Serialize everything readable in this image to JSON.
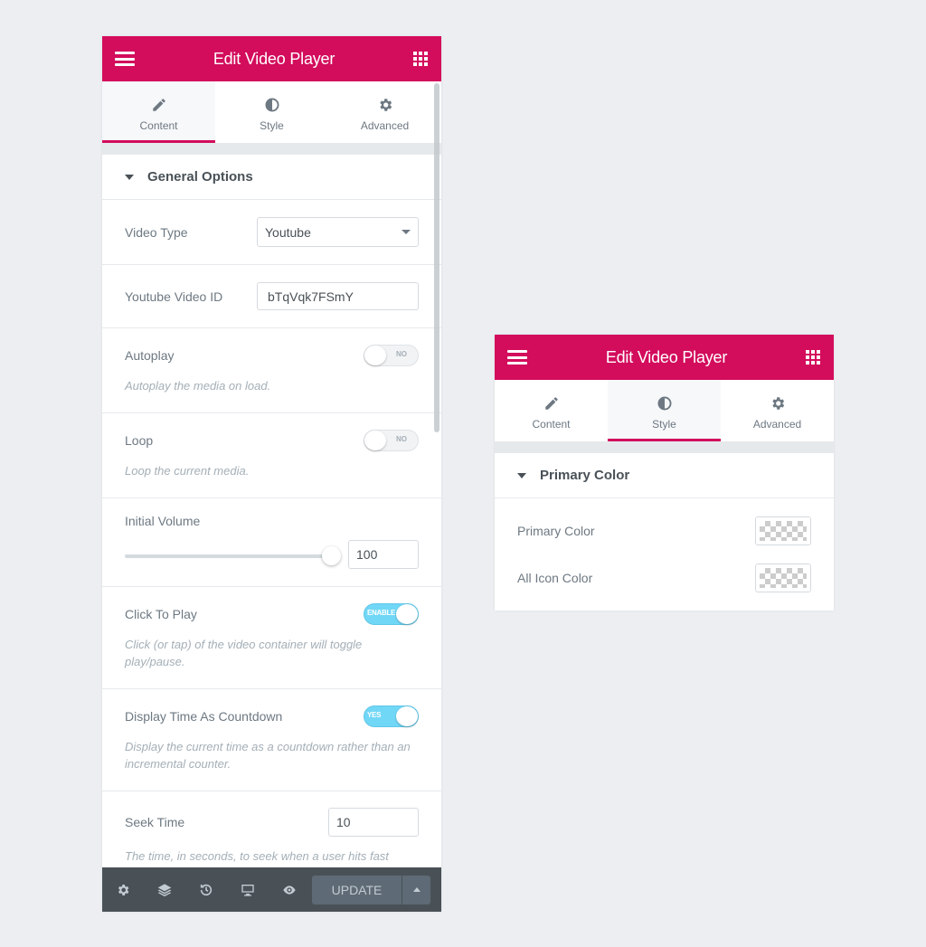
{
  "left_panel": {
    "header_title": "Edit Video Player",
    "tabs": [
      {
        "label": "Content",
        "icon": "pencil-icon",
        "active": true
      },
      {
        "label": "Style",
        "icon": "contrast-icon",
        "active": false
      },
      {
        "label": "Advanced",
        "icon": "gear-icon",
        "active": false
      }
    ],
    "section_title": "General Options",
    "video_type": {
      "label": "Video Type",
      "value": "Youtube"
    },
    "video_id": {
      "label": "Youtube Video ID",
      "value": "bTqVqk7FSmY"
    },
    "autoplay": {
      "label": "Autoplay",
      "desc": "Autoplay the media on load.",
      "switch_text": "NO",
      "on": false
    },
    "loop": {
      "label": "Loop",
      "desc": "Loop the current media.",
      "switch_text": "NO",
      "on": false
    },
    "initial_volume": {
      "label": "Initial Volume",
      "value": "100",
      "level": 1.0
    },
    "click_to_play": {
      "label": "Click To Play",
      "desc": "Click (or tap) of the video container will toggle play/pause.",
      "switch_text": "ENABLE",
      "on": true
    },
    "countdown": {
      "label": "Display Time As Countdown",
      "desc": "Display the current time as a countdown rather than an incremental counter.",
      "switch_text": "YES",
      "on": true
    },
    "seek_time": {
      "label": "Seek Time",
      "value": "10",
      "desc": "The time, in seconds, to seek when a user hits fast"
    },
    "footer": {
      "update_label": "UPDATE"
    }
  },
  "right_panel": {
    "header_title": "Edit Video Player",
    "tabs": [
      {
        "label": "Content",
        "icon": "pencil-icon",
        "active": false
      },
      {
        "label": "Style",
        "icon": "contrast-icon",
        "active": true
      },
      {
        "label": "Advanced",
        "icon": "gear-icon",
        "active": false
      }
    ],
    "section_title": "Primary Color",
    "colors": [
      {
        "label": "Primary Color"
      },
      {
        "label": "All Icon Color"
      }
    ]
  },
  "colors": {
    "brand": "#d30c5c",
    "switch_on": "#71d7f7",
    "footer_bg": "#495157"
  }
}
